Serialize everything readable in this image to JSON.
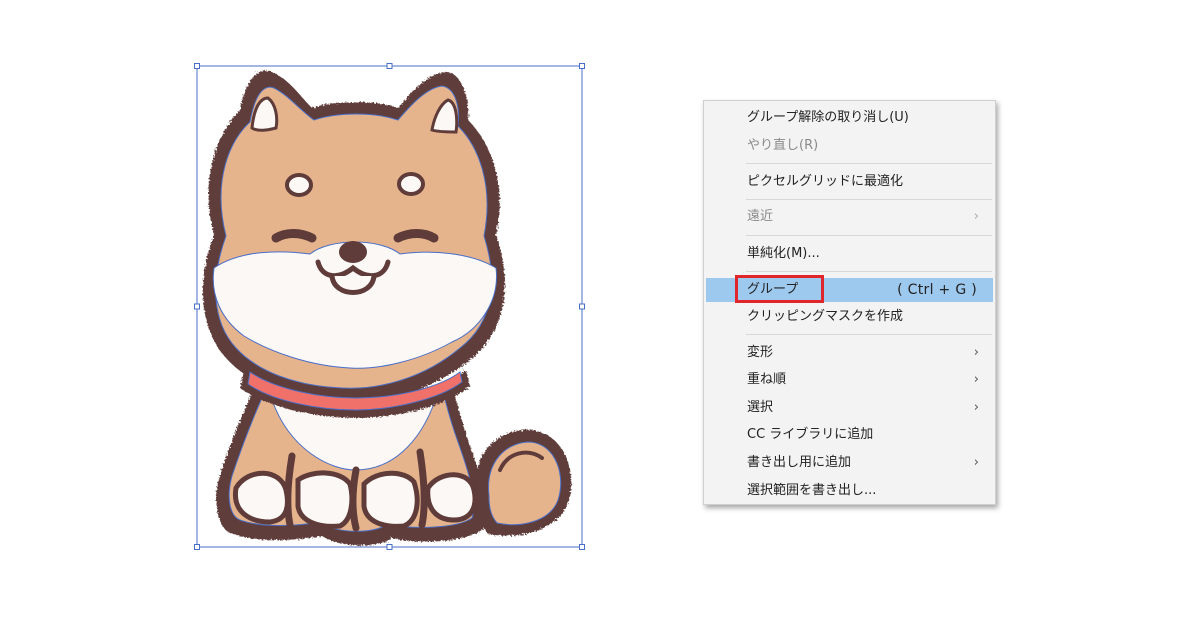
{
  "colors": {
    "fur": "#e6b48c",
    "outline": "#5f3c3a",
    "white_fur": "#fbf8f6",
    "collar": "#f0716a",
    "path_stroke": "#4a6fc8",
    "selection": "#4a6fc8",
    "menu_bg": "#f3f3f3",
    "menu_highlight": "#9ec9ef",
    "red_frame": "#e0252b"
  },
  "artwork": {
    "subject": "shiba-inu-illustration",
    "selected": true
  },
  "context_menu": {
    "items": [
      {
        "label": "グループ解除の取り消し(U)",
        "disabled": false
      },
      {
        "label": "やり直し(R)",
        "disabled": true
      },
      {
        "label": "ピクセルグリッドに最適化",
        "disabled": false
      },
      {
        "label": "遠近",
        "disabled": true,
        "submenu": "›"
      },
      {
        "label": "単純化(M)...",
        "disabled": false
      },
      {
        "label": "グループ",
        "disabled": false,
        "shortcut": "( Ctrl + G )",
        "highlighted": true
      },
      {
        "label": "クリッピングマスクを作成",
        "disabled": false
      },
      {
        "label": "変形",
        "disabled": false,
        "submenu": "›"
      },
      {
        "label": "重ね順",
        "disabled": false,
        "submenu": "›"
      },
      {
        "label": "選択",
        "disabled": false,
        "submenu": "›"
      },
      {
        "label": "CC ライブラリに追加",
        "disabled": false
      },
      {
        "label": "書き出し用に追加",
        "disabled": false,
        "submenu": "›"
      },
      {
        "label": "選択範囲を書き出し...",
        "disabled": false
      }
    ]
  }
}
